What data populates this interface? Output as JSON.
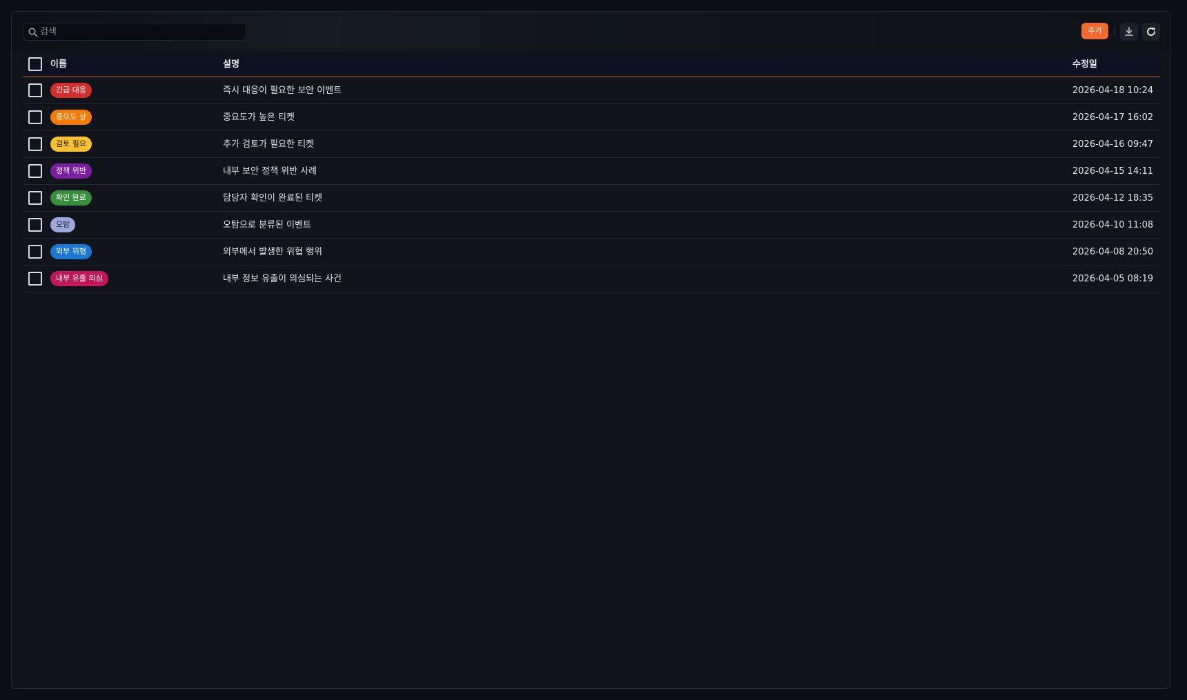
{
  "toolbar": {
    "search_placeholder": "검색",
    "add_label": "추가"
  },
  "table": {
    "headers": {
      "name": "이름",
      "description": "설명",
      "modified": "수정일"
    },
    "rows": [
      {
        "tag": "긴급 대응",
        "tag_color": "#d32f2f",
        "tag_text_color": "#ffffff",
        "description": "즉시 대응이 필요한 보안 이벤트",
        "modified": "2026-04-18 10:24"
      },
      {
        "tag": "중요도 상",
        "tag_color": "#f57c00",
        "tag_text_color": "#ffffff",
        "description": "중요도가 높은 티켓",
        "modified": "2026-04-17 16:02"
      },
      {
        "tag": "검토 필요",
        "tag_color": "#fbc02d",
        "tag_text_color": "#1b1b1b",
        "description": "추가 검토가 필요한 티켓",
        "modified": "2026-04-16 09:47"
      },
      {
        "tag": "정책 위반",
        "tag_color": "#7b1fa2",
        "tag_text_color": "#ffffff",
        "description": "내부 보안 정책 위반 사례",
        "modified": "2026-04-15 14:11"
      },
      {
        "tag": "확인 완료",
        "tag_color": "#388e3c",
        "tag_text_color": "#ffffff",
        "description": "담당자 확인이 완료된 티켓",
        "modified": "2026-04-12 18:35"
      },
      {
        "tag": "오탐",
        "tag_color": "#9fa8da",
        "tag_text_color": "#1b1f2e",
        "description": "오탐으로 분류된 이벤트",
        "modified": "2026-04-10 11:08"
      },
      {
        "tag": "외부 위협",
        "tag_color": "#1976d2",
        "tag_text_color": "#ffffff",
        "description": "외부에서 발생한 위협 행위",
        "modified": "2026-04-08 20:50"
      },
      {
        "tag": "내부 유출 의심",
        "tag_color": "#c2185b",
        "tag_text_color": "#ffffff",
        "description": "내부 정보 유출이 의심되는 사건",
        "modified": "2026-04-05 08:19"
      }
    ]
  },
  "colors": {
    "accent": "#f26a2f",
    "background": "#11141a",
    "header_border": "#e06a2f"
  }
}
